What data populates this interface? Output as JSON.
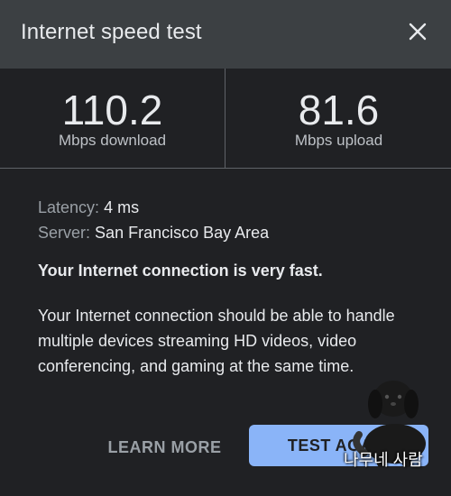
{
  "dialog": {
    "title": "Internet speed test",
    "close_icon": "close-icon"
  },
  "results": {
    "download": {
      "value": "110.2",
      "unit": "Mbps download"
    },
    "upload": {
      "value": "81.6",
      "unit": "Mbps upload"
    }
  },
  "details": {
    "latency_label": "Latency:",
    "latency_value": "4 ms",
    "server_label": "Server:",
    "server_value": "San Francisco Bay Area"
  },
  "message": {
    "headline": "Your Internet connection is very fast.",
    "description": "Your Internet connection should be able to handle multiple devices streaming HD videos, video conferencing, and gaming at the same time."
  },
  "actions": {
    "learn_more_label": "LEARN MORE",
    "test_again_label": "TEST AGAIN"
  },
  "watermark": {
    "text": "나무네 사람",
    "icon": "dog-sticker"
  },
  "colors": {
    "background": "#202124",
    "header": "#3c4043",
    "accent": "#8ab4f8",
    "muted_text": "#9aa0a6"
  }
}
